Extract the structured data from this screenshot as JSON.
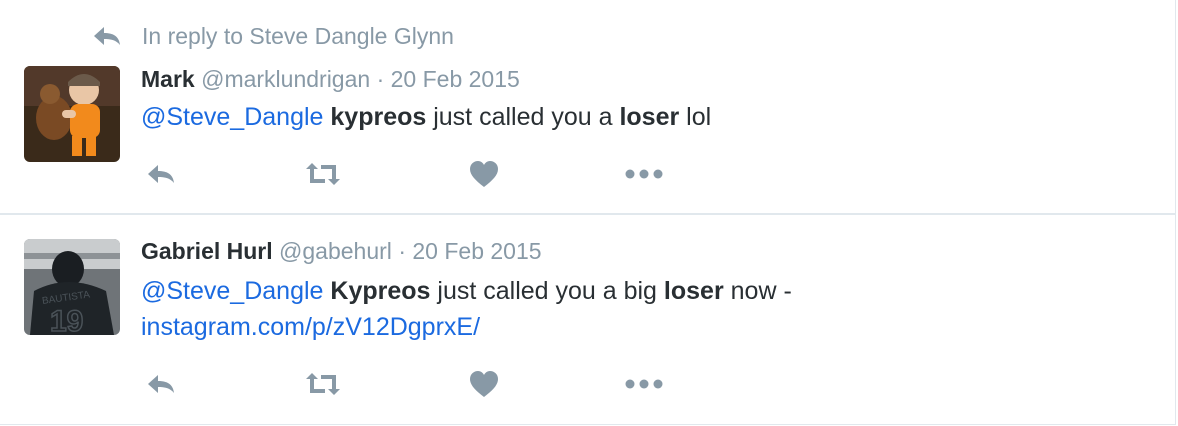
{
  "colors": {
    "text": "#292f33",
    "muted": "#8899a6",
    "link": "#1b6ae0",
    "border": "#e1e8ed"
  },
  "reply_context": {
    "icon": "reply-arrow-icon",
    "text": "In reply to Steve Dangle Glynn"
  },
  "tweets": [
    {
      "name": "Mark",
      "handle": "@marklundrigan",
      "separator": "·",
      "time": "20 Feb 2015",
      "text_parts": {
        "mention": "@Steve_Dangle",
        "b1": "kypreos",
        "t1": " just called you a ",
        "b2": "loser",
        "t2": " lol"
      },
      "avatar": "toddler-with-teddy-bear-photo"
    },
    {
      "name": "Gabriel Hurl",
      "handle": "@gabehurl",
      "separator": "·",
      "time": "20 Feb 2015",
      "text_parts": {
        "mention": "@Steve_Dangle",
        "b1": "Kypreos",
        "t1": " just called you a big ",
        "b2": "loser",
        "t2": " now -",
        "link": "instagram.com/p/zV12DgprxE/"
      },
      "avatar": "blue-jays-bautista-19-jersey-photo",
      "avatar_jersey": {
        "name": "BAUTISTA",
        "number": "19"
      }
    }
  ],
  "action_icons": [
    "reply-icon",
    "retweet-icon",
    "like-heart-icon",
    "more-options-icon"
  ]
}
